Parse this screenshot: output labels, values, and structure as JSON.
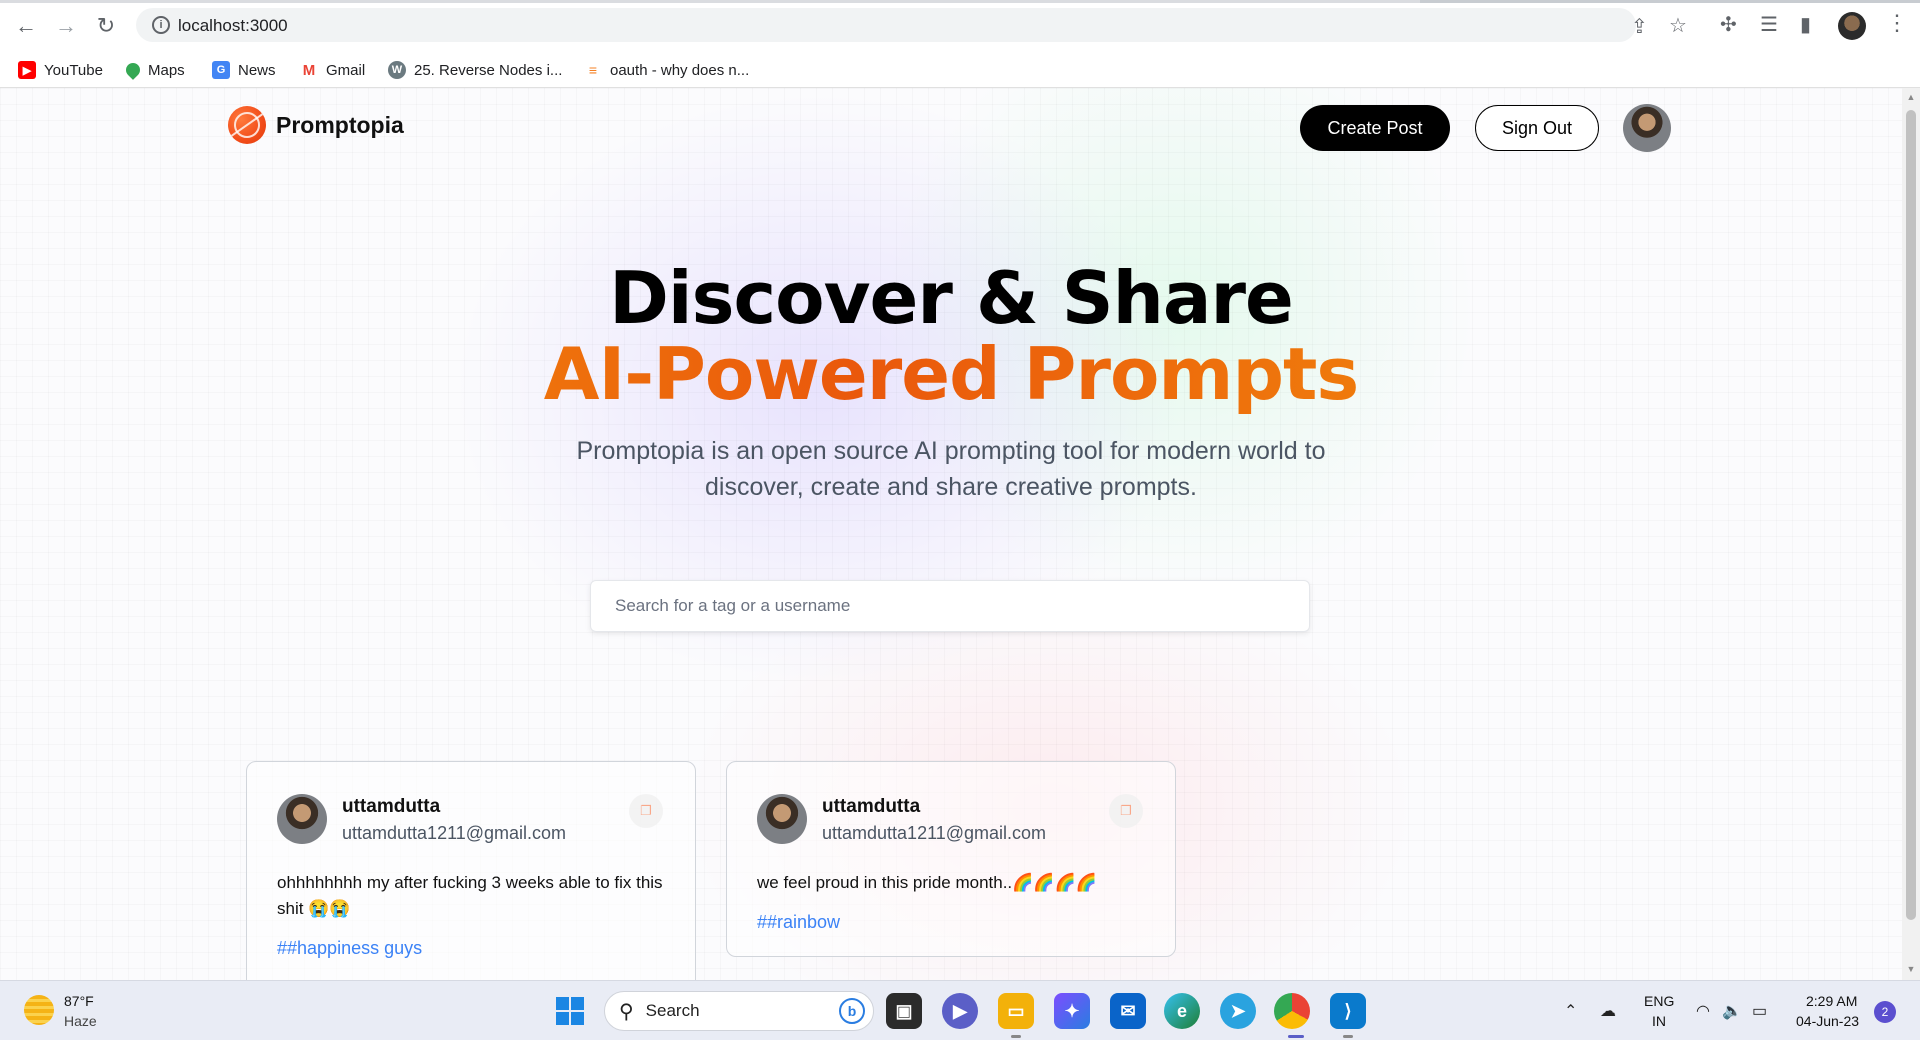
{
  "browser": {
    "url": "localhost:3000",
    "bookmarks": [
      {
        "label": "YouTube",
        "icon": "youtube-icon",
        "color": "#ff0000"
      },
      {
        "label": "Maps",
        "icon": "maps-icon",
        "color": "#34a853"
      },
      {
        "label": "News",
        "icon": "news-icon",
        "color": "#4285f4"
      },
      {
        "label": "Gmail",
        "icon": "gmail-icon",
        "color": "#ea4335"
      },
      {
        "label": "25. Reverse Nodes i...",
        "icon": "w-icon",
        "color": "#6b7a80"
      },
      {
        "label": "oauth - why does n...",
        "icon": "stackoverflow-icon",
        "color": "#f48024"
      }
    ]
  },
  "navbar": {
    "brand": "Promptopia",
    "create_post": "Create Post",
    "sign_out": "Sign Out"
  },
  "hero": {
    "line1": "Discover & Share",
    "line2": "AI-Powered Prompts",
    "description": "Promptopia is an open source AI prompting tool for modern world to discover, create and share creative prompts."
  },
  "search": {
    "placeholder": "Search for a tag or a username"
  },
  "posts": [
    {
      "username": "uttamdutta",
      "email": "uttamdutta1211@gmail.com",
      "prompt": "ohhhhhhhh my after fucking 3 weeks able to fix this shit 😭😭",
      "tag": "##happiness guys"
    },
    {
      "username": "uttamdutta",
      "email": "uttamdutta1211@gmail.com",
      "prompt": "we feel proud in this pride month..🌈🌈🌈🌈",
      "tag": "##rainbow"
    }
  ],
  "taskbar": {
    "weather_temp": "87°F",
    "weather_desc": "Haze",
    "search_label": "Search",
    "lang_top": "ENG",
    "lang_bottom": "IN",
    "time": "2:29 AM",
    "date": "04-Jun-23",
    "notifications": "2"
  },
  "colors": {
    "accent_orange": "#ea580c",
    "tag_blue": "#3b82f6"
  }
}
